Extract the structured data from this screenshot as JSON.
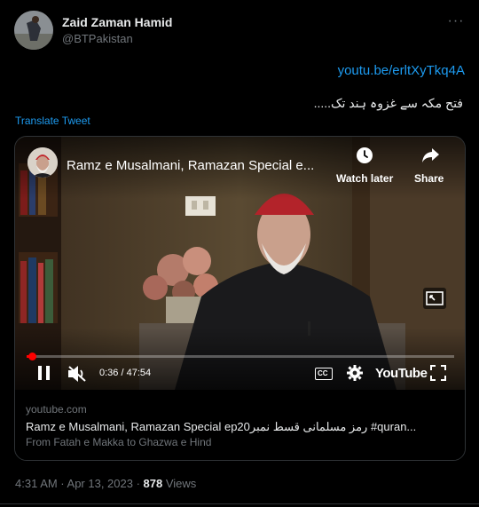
{
  "tweet": {
    "author_name": "Zaid Zaman Hamid",
    "author_handle": "@BTPakistan",
    "link_text": "youtu.be/erltXyTkq4A",
    "urdu_text": "فتح مکہ سے غزوہ ہند تک.....",
    "translate_label": "Translate Tweet",
    "more_glyph": "···"
  },
  "video": {
    "title": "Ramz e Musalmani, Ramazan Special e...",
    "watch_later_label": "Watch later",
    "share_label": "Share",
    "time": "0:36 / 47:54",
    "progress_fraction": 0.0126,
    "youtube_wordmark": "YouTube",
    "cc_label": "CC"
  },
  "card": {
    "domain": "youtube.com",
    "title": "Ramz e Musalmani, Ramazan Special ep20رمز مسلمانی قسط نمبر #quran...",
    "description": "From Fatah e Makka to Ghazwa e Hind"
  },
  "meta": {
    "time": "4:31 AM · Apr 13, 2023 · ",
    "views_count": "878",
    "views_label": " Views"
  },
  "colors": {
    "accent": "#1d9bf0",
    "background": "#000000",
    "secondary_text": "#71767b",
    "progress": "#ff0000"
  }
}
